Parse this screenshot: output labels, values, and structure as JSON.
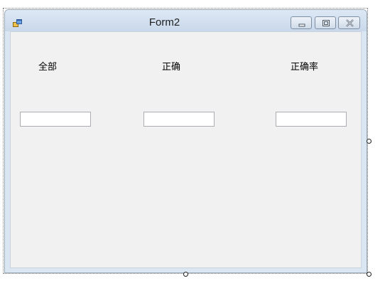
{
  "window": {
    "title": "Form2",
    "icon": "form-icon",
    "caption_buttons": [
      "minimize-icon",
      "restore-icon",
      "close-icon"
    ]
  },
  "form": {
    "labels": [
      "全部",
      "正确",
      "正确率"
    ],
    "textboxes": [
      {
        "value": "",
        "placeholder": ""
      },
      {
        "value": "",
        "placeholder": ""
      },
      {
        "value": "",
        "placeholder": ""
      }
    ]
  },
  "designer": {
    "resize_handles": [
      "right",
      "bottom",
      "bottom-right"
    ]
  }
}
